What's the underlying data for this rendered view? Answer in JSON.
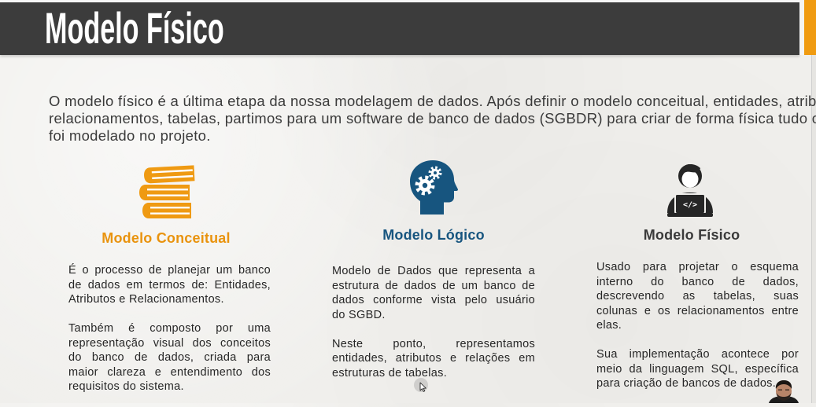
{
  "slide": {
    "title": "Modelo Físico",
    "header_color": "#3c3c3c",
    "accent_color": "#f09b11",
    "intro_lines": [
      "O modelo físico é a última etapa da nossa modelagem de dados. Após definir o modelo conceitual, entidades, atrib",
      "relacionamentos, tabelas, partimos para um software de banco de dados (SGBDR) para criar de forma física tudo o",
      "foi modelado no projeto."
    ]
  },
  "columns": [
    {
      "icon": "books-icon",
      "icon_color": "#ef9a12",
      "title": "Modelo Conceitual",
      "title_color": "#e9930e",
      "paragraphs": [
        {
          "lines": [
            "É o processo de planejar um banco",
            "de dados em termos de: Entidades,",
            "Atributos e Relacionamentos."
          ]
        },
        {
          "lines": [
            "Também é composto por uma",
            "representação visual dos conceitos",
            "do banco de dados, criada para",
            "maior clareza e entendimento dos",
            "requisitos do sistema."
          ]
        }
      ]
    },
    {
      "icon": "head-gears-icon",
      "icon_color": "#17557f",
      "title": "Modelo Lógico",
      "title_color": "#17557f",
      "paragraphs": [
        {
          "lines": [
            "Modelo de Dados que representa a",
            "estrutura de dados de um banco de",
            "dados conforme vista pelo usuário",
            "do SGBD."
          ]
        },
        {
          "lines": [
            "Neste ponto, representamos",
            "entidades, atributos e relações em",
            "estruturas de tabelas."
          ]
        }
      ]
    },
    {
      "icon": "developer-laptop-icon",
      "icon_color": "#262626",
      "icon_label": "</>",
      "title": "Modelo Físico",
      "title_color": "#3a3a3a",
      "paragraphs": [
        {
          "lines": [
            "Usado para projetar o esquema",
            "interno do banco de dados,",
            "descrevendo as tabelas, suas",
            "colunas e os relacionamentos entre",
            "elas."
          ]
        },
        {
          "lines": [
            "Sua implementação acontece por",
            "meio da linguagem SQL, específica",
            "para criação de bancos de dados."
          ]
        }
      ]
    }
  ]
}
